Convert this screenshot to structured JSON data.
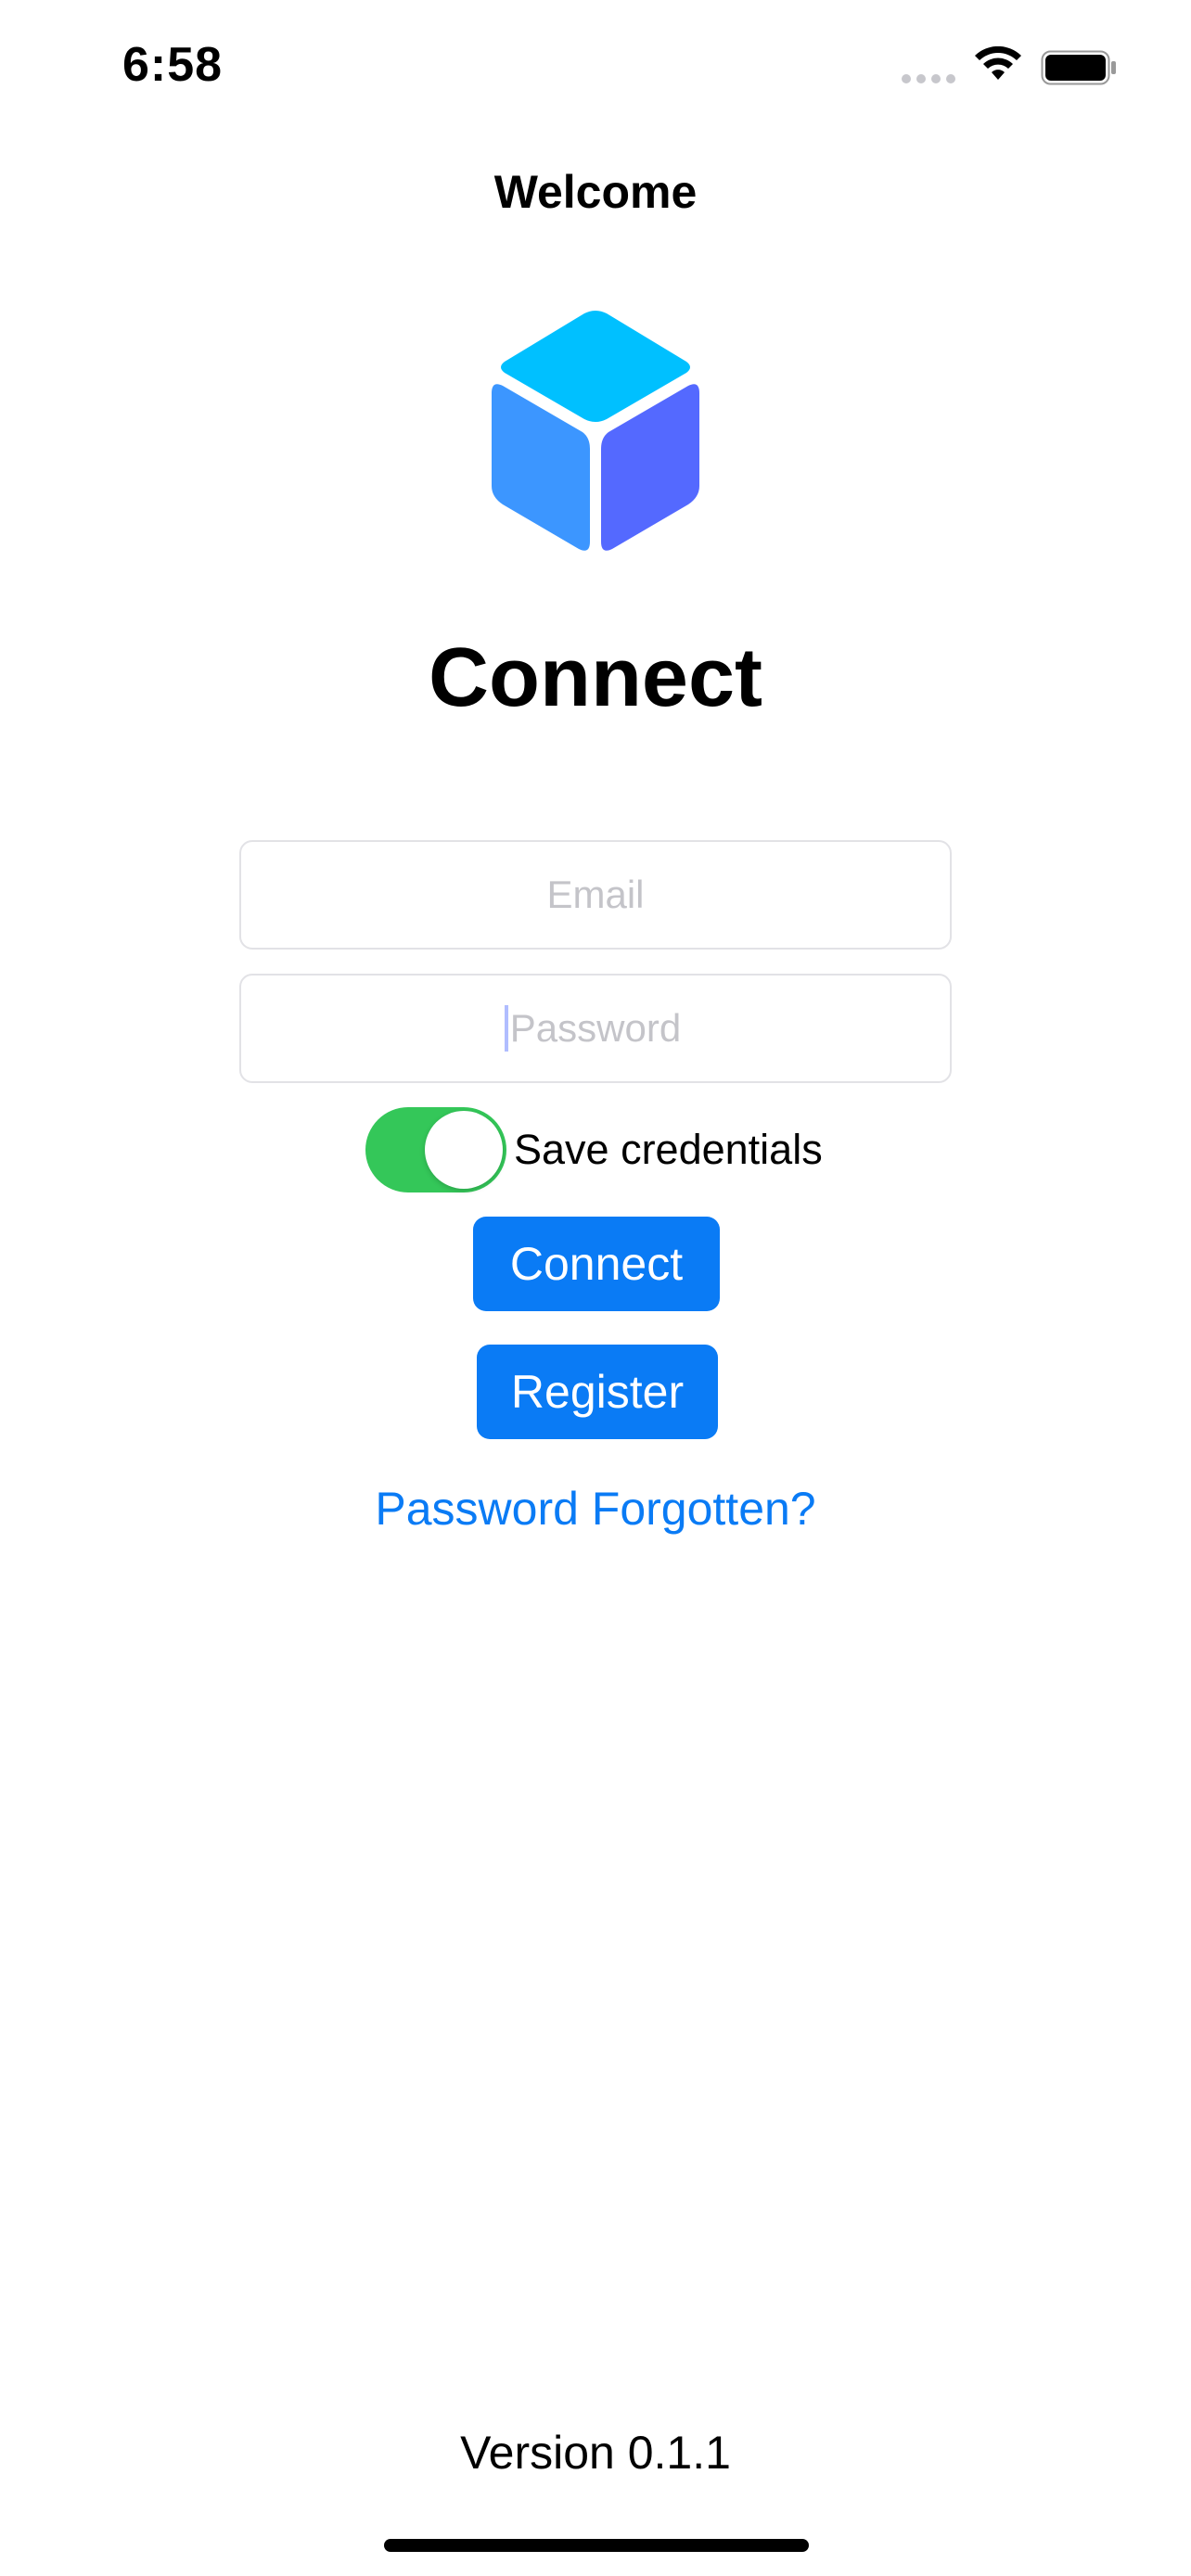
{
  "status_bar": {
    "time": "6:58",
    "icons": [
      "signal-dots-icon",
      "wifi-icon",
      "battery-icon"
    ]
  },
  "nav": {
    "title": "Welcome"
  },
  "logo": {
    "icon": "cube-logo-icon",
    "colors": {
      "top": "#00c0ff",
      "left": "#3c96ff",
      "right": "#5469ff"
    }
  },
  "app_title": "Connect",
  "form": {
    "email": {
      "value": "",
      "placeholder": "Email"
    },
    "password": {
      "value": "",
      "placeholder": "Password"
    },
    "save_credentials": {
      "label": "Save credentials",
      "on": true
    }
  },
  "buttons": {
    "connect": "Connect",
    "register": "Register",
    "forgot": "Password Forgotten?"
  },
  "version": "Version 0.1.1",
  "colors": {
    "accent": "#0a7bf5",
    "toggle_on": "#34c759",
    "placeholder": "#c4c4c9"
  }
}
